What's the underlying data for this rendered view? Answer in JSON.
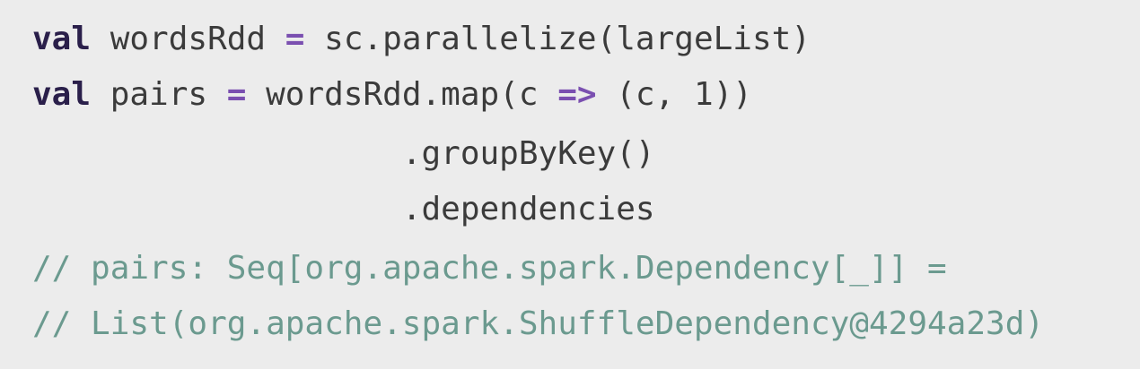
{
  "code": {
    "line1": {
      "keyword": "val",
      "before_op": " wordsRdd ",
      "op": "=",
      "after_op": " sc.parallelize(largeList)"
    },
    "line2": {
      "keyword": "val",
      "before_op1": " pairs ",
      "op1": "=",
      "between_ops": " wordsRdd.map(c ",
      "op2": "=>",
      "after_op2": " (c, 1))"
    },
    "line3": {
      "indent": "                   ",
      "text": ".groupByKey()"
    },
    "line4": {
      "indent": "                   ",
      "text": ".dependencies"
    },
    "line5": {
      "comment": "// pairs: Seq[org.apache.spark.Dependency[_]] ="
    },
    "line6": {
      "comment": "// List(org.apache.spark.ShuffleDependency@4294a23d)"
    }
  },
  "colors": {
    "background": "#ececec",
    "keyword": "#2a1f4a",
    "operator": "#7a4fb0",
    "comment": "#6b9a8f",
    "text": "#3b3b3b"
  }
}
